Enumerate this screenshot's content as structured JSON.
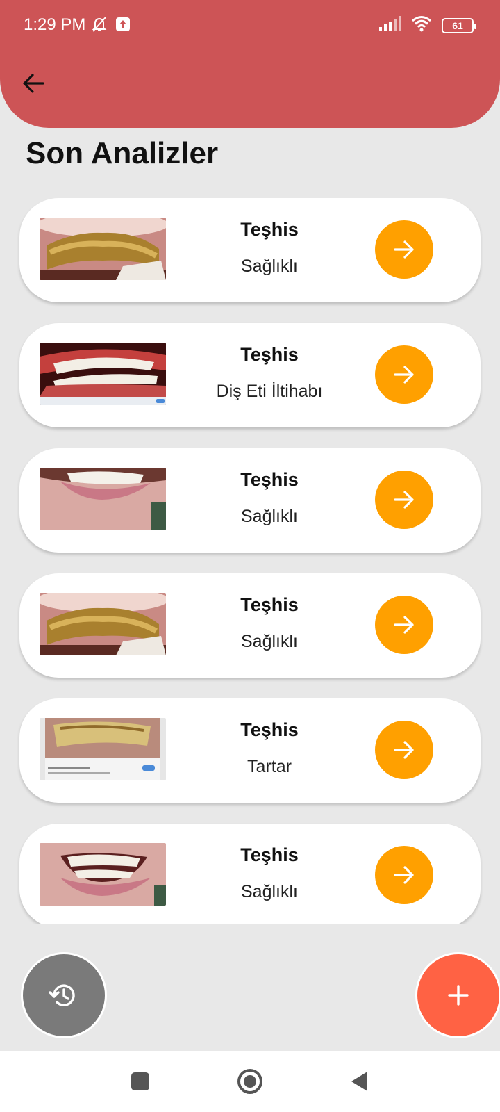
{
  "status_bar": {
    "time": "1:29 PM",
    "battery": "61",
    "icons": [
      "mute-bell-icon",
      "upload-notification-icon",
      "signal-icon",
      "wifi-icon",
      "battery-icon"
    ]
  },
  "colors": {
    "header": "#cd5456",
    "background": "#e8e8e8",
    "arrow_button": "#ffa000",
    "history_fab": "#7a7a7a",
    "add_fab": "#ff6244"
  },
  "page": {
    "title": "Son Analizler"
  },
  "analyses": [
    {
      "label": "Teşhis",
      "value": "Sağlıklı",
      "thumb": "tartar-teeth-photo"
    },
    {
      "label": "Teşhis",
      "value": "Diş Eti İltihabı",
      "thumb": "gingivitis-web-photo"
    },
    {
      "label": "Teşhis",
      "value": "Sağlıklı",
      "thumb": "lower-lip-teeth-photo"
    },
    {
      "label": "Teşhis",
      "value": "Sağlıklı",
      "thumb": "tartar-teeth-photo"
    },
    {
      "label": "Teşhis",
      "value": "Tartar",
      "thumb": "calculus-web-photo"
    },
    {
      "label": "Teşhis",
      "value": "Sağlıklı",
      "thumb": "smile-teeth-photo"
    }
  ],
  "fabs": {
    "history_icon": "history-icon",
    "add_icon": "plus-icon"
  },
  "nav": {
    "icons": [
      "recents-square-icon",
      "home-circle-icon",
      "back-triangle-icon"
    ]
  }
}
